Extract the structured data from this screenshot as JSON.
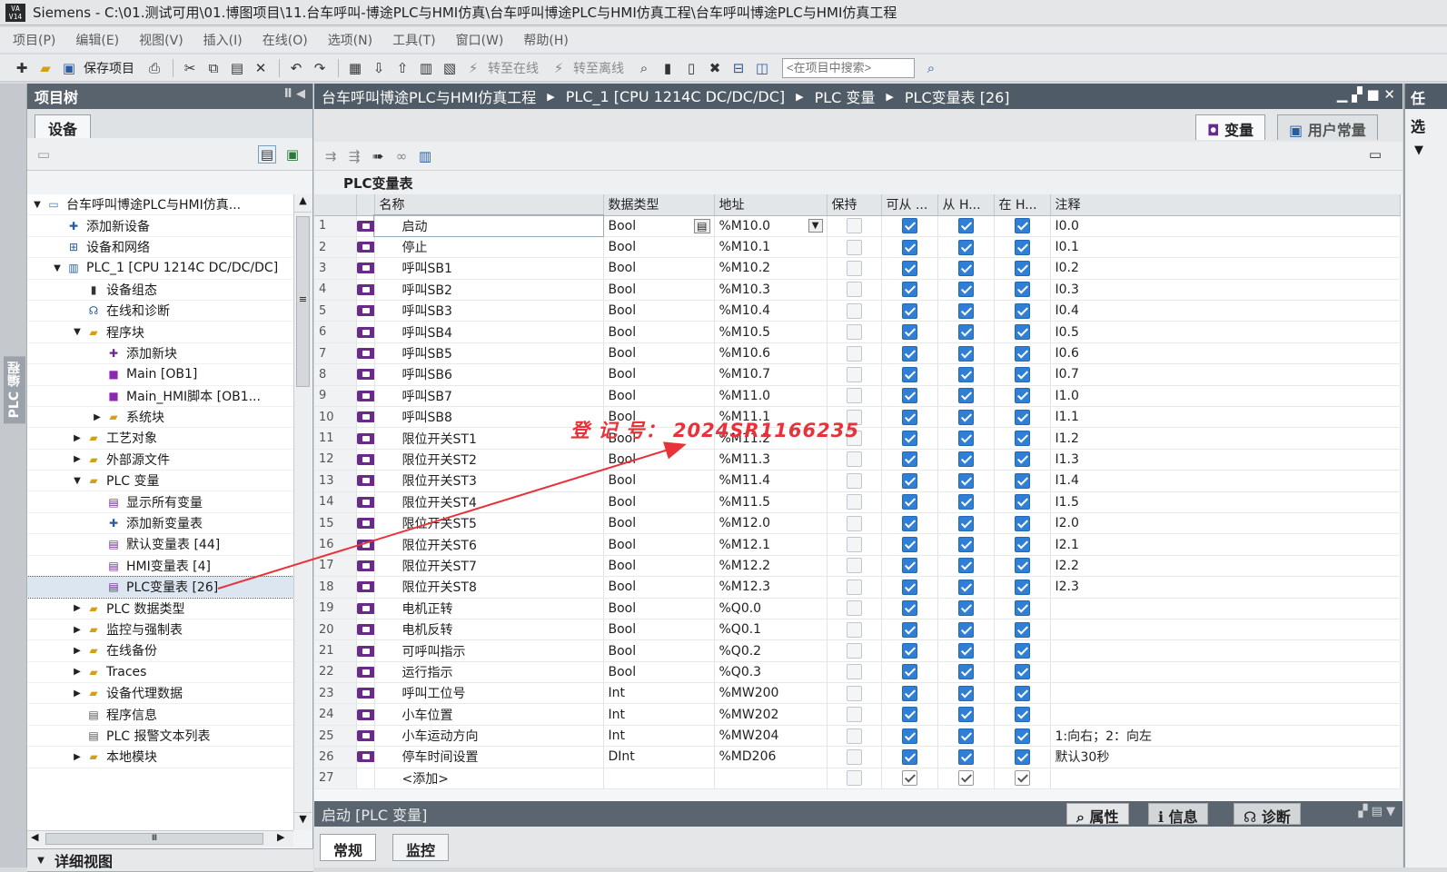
{
  "title": {
    "logo": "VA\nV14",
    "text": "Siemens  -  C:\\01.测试可用\\01.博图项目\\11.台车呼叫-博途PLC与HMI仿真\\台车呼叫博途PLC与HMI仿真工程\\台车呼叫博途PLC与HMI仿真工程"
  },
  "menu": [
    "项目(P)",
    "编辑(E)",
    "视图(V)",
    "插入(I)",
    "在线(O)",
    "选项(N)",
    "工具(T)",
    "窗口(W)",
    "帮助(H)"
  ],
  "toolbar": {
    "save_label": "保存项目",
    "go_online": "转至在线",
    "go_offline": "转至离线",
    "search_placeholder": "<在项目中搜索>"
  },
  "left_strip_label": "PLC 编程",
  "project_tree": {
    "header": "项目树",
    "tab": "设备",
    "items": [
      {
        "label": "台车呼叫博途PLC与HMI仿真...",
        "level": 0,
        "twisty": "▼",
        "icon": "project-icon"
      },
      {
        "label": "添加新设备",
        "level": 1,
        "twisty": "",
        "icon": "add-device-icon"
      },
      {
        "label": "设备和网络",
        "level": 1,
        "twisty": "",
        "icon": "network-icon"
      },
      {
        "label": "PLC_1 [CPU 1214C DC/DC/DC]",
        "level": 1,
        "twisty": "▼",
        "icon": "plc-icon"
      },
      {
        "label": "设备组态",
        "level": 2,
        "twisty": "",
        "icon": "device-config-icon"
      },
      {
        "label": "在线和诊断",
        "level": 2,
        "twisty": "",
        "icon": "diagnostics-icon"
      },
      {
        "label": "程序块",
        "level": 2,
        "twisty": "▼",
        "icon": "folder-icon"
      },
      {
        "label": "添加新块",
        "level": 3,
        "twisty": "",
        "icon": "add-block-icon"
      },
      {
        "label": "Main [OB1]",
        "level": 3,
        "twisty": "",
        "icon": "ob-icon"
      },
      {
        "label": "Main_HMI脚本 [OB1...",
        "level": 3,
        "twisty": "",
        "icon": "ob-icon"
      },
      {
        "label": "系统块",
        "level": 3,
        "twisty": "▶",
        "icon": "folder-icon"
      },
      {
        "label": "工艺对象",
        "level": 2,
        "twisty": "▶",
        "icon": "folder-icon"
      },
      {
        "label": "外部源文件",
        "level": 2,
        "twisty": "▶",
        "icon": "folder-icon"
      },
      {
        "label": "PLC 变量",
        "level": 2,
        "twisty": "▼",
        "icon": "folder-icon"
      },
      {
        "label": "显示所有变量",
        "level": 3,
        "twisty": "",
        "icon": "tag-table-icon"
      },
      {
        "label": "添加新变量表",
        "level": 3,
        "twisty": "",
        "icon": "add-tag-table-icon"
      },
      {
        "label": "默认变量表 [44]",
        "level": 3,
        "twisty": "",
        "icon": "tag-table-icon"
      },
      {
        "label": "HMI变量表 [4]",
        "level": 3,
        "twisty": "",
        "icon": "tag-table-icon"
      },
      {
        "label": "PLC变量表 [26]",
        "level": 3,
        "twisty": "",
        "icon": "tag-table-icon",
        "selected": true
      },
      {
        "label": "PLC 数据类型",
        "level": 2,
        "twisty": "▶",
        "icon": "folder-icon"
      },
      {
        "label": "监控与强制表",
        "level": 2,
        "twisty": "▶",
        "icon": "folder-icon"
      },
      {
        "label": "在线备份",
        "level": 2,
        "twisty": "▶",
        "icon": "folder-icon"
      },
      {
        "label": "Traces",
        "level": 2,
        "twisty": "▶",
        "icon": "folder-icon"
      },
      {
        "label": "设备代理数据",
        "level": 2,
        "twisty": "▶",
        "icon": "folder-icon"
      },
      {
        "label": "程序信息",
        "level": 2,
        "twisty": "",
        "icon": "program-info-icon"
      },
      {
        "label": "PLC 报警文本列表",
        "level": 2,
        "twisty": "",
        "icon": "alarm-text-icon"
      },
      {
        "label": "本地模块",
        "level": 2,
        "twisty": "▶",
        "icon": "folder-icon"
      }
    ],
    "hscroll_grip": "Ⅲ",
    "vscroll_grip": "≡",
    "detail_view": "详细视图"
  },
  "editor": {
    "breadcrumb": [
      "台车呼叫博途PLC与HMI仿真工程",
      "PLC_1 [CPU 1214C DC/DC/DC]",
      "PLC 变量",
      "PLC变量表 [26]"
    ],
    "tab_tags": "变量",
    "tab_user_constants": "用户常量",
    "table_title": "PLC变量表",
    "columns": [
      "",
      "名称",
      "数据类型",
      "地址",
      "保持",
      "可从 ...",
      "从 H...",
      "在 H...",
      "注释"
    ],
    "rows": [
      {
        "n": "1",
        "name": "启动",
        "type": "Bool",
        "addr": "%M10.0",
        "comment": "I0.0"
      },
      {
        "n": "2",
        "name": "停止",
        "type": "Bool",
        "addr": "%M10.1",
        "comment": "I0.1"
      },
      {
        "n": "3",
        "name": "呼叫SB1",
        "type": "Bool",
        "addr": "%M10.2",
        "comment": "I0.2"
      },
      {
        "n": "4",
        "name": "呼叫SB2",
        "type": "Bool",
        "addr": "%M10.3",
        "comment": "I0.3"
      },
      {
        "n": "5",
        "name": "呼叫SB3",
        "type": "Bool",
        "addr": "%M10.4",
        "comment": "I0.4"
      },
      {
        "n": "6",
        "name": "呼叫SB4",
        "type": "Bool",
        "addr": "%M10.5",
        "comment": "I0.5"
      },
      {
        "n": "7",
        "name": "呼叫SB5",
        "type": "Bool",
        "addr": "%M10.6",
        "comment": "I0.6"
      },
      {
        "n": "8",
        "name": "呼叫SB6",
        "type": "Bool",
        "addr": "%M10.7",
        "comment": "I0.7"
      },
      {
        "n": "9",
        "name": "呼叫SB7",
        "type": "Bool",
        "addr": "%M11.0",
        "comment": "I1.0"
      },
      {
        "n": "10",
        "name": "呼叫SB8",
        "type": "Bool",
        "addr": "%M11.1",
        "comment": "I1.1"
      },
      {
        "n": "11",
        "name": "限位开关ST1",
        "type": "Bool",
        "addr": "%M11.2",
        "comment": "I1.2"
      },
      {
        "n": "12",
        "name": "限位开关ST2",
        "type": "Bool",
        "addr": "%M11.3",
        "comment": "I1.3"
      },
      {
        "n": "13",
        "name": "限位开关ST3",
        "type": "Bool",
        "addr": "%M11.4",
        "comment": "I1.4"
      },
      {
        "n": "14",
        "name": "限位开关ST4",
        "type": "Bool",
        "addr": "%M11.5",
        "comment": "I1.5"
      },
      {
        "n": "15",
        "name": "限位开关ST5",
        "type": "Bool",
        "addr": "%M12.0",
        "comment": "I2.0"
      },
      {
        "n": "16",
        "name": "限位开关ST6",
        "type": "Bool",
        "addr": "%M12.1",
        "comment": "I2.1"
      },
      {
        "n": "17",
        "name": "限位开关ST7",
        "type": "Bool",
        "addr": "%M12.2",
        "comment": "I2.2"
      },
      {
        "n": "18",
        "name": "限位开关ST8",
        "type": "Bool",
        "addr": "%M12.3",
        "comment": "I2.3"
      },
      {
        "n": "19",
        "name": "电机正转",
        "type": "Bool",
        "addr": "%Q0.0",
        "comment": ""
      },
      {
        "n": "20",
        "name": "电机反转",
        "type": "Bool",
        "addr": "%Q0.1",
        "comment": ""
      },
      {
        "n": "21",
        "name": "可呼叫指示",
        "type": "Bool",
        "addr": "%Q0.2",
        "comment": ""
      },
      {
        "n": "22",
        "name": "运行指示",
        "type": "Bool",
        "addr": "%Q0.3",
        "comment": ""
      },
      {
        "n": "23",
        "name": "呼叫工位号",
        "type": "Int",
        "addr": "%MW200",
        "comment": ""
      },
      {
        "n": "24",
        "name": "小车位置",
        "type": "Int",
        "addr": "%MW202",
        "comment": ""
      },
      {
        "n": "25",
        "name": "小车运动方向",
        "type": "Int",
        "addr": "%MW204",
        "comment": "1:向右；2：向左"
      },
      {
        "n": "26",
        "name": "停车时间设置",
        "type": "DInt",
        "addr": "%MD206",
        "comment": "默认30秒"
      },
      {
        "n": "27",
        "name": "<添加>",
        "type": "",
        "addr": "",
        "comment": "",
        "placeholder": true
      }
    ],
    "watermark": "登 记 号： 2024SR1166235",
    "properties_title": "启动 [PLC 变量]",
    "prop_tabs": [
      "属性",
      "信息",
      "诊断"
    ],
    "sub_tabs": [
      "常规",
      "监控"
    ]
  },
  "right_panel": {
    "header": "任",
    "label": "选"
  },
  "colors": {
    "header_bg": "#4f5b66",
    "check_blue": "#2f7fd6",
    "tag_icon": "#6a2a8a",
    "watermark": "#e8323a"
  }
}
